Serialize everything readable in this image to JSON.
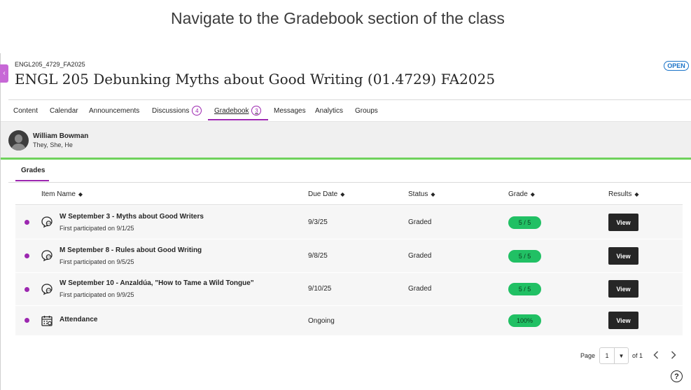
{
  "instruction": "Navigate to the Gradebook section of the class",
  "course": {
    "code": "ENGL205_4729_FA2025",
    "title": "ENGL 205 Debunking Myths about Good Writing (01.4729) FA2025",
    "status_badge": "OPEN"
  },
  "nav": {
    "tabs": [
      {
        "label": "Content"
      },
      {
        "label": "Calendar"
      },
      {
        "label": "Announcements"
      },
      {
        "label": "Discussions",
        "count": "4"
      },
      {
        "label": "Gradebook",
        "count": "3",
        "active": true
      },
      {
        "label": "Messages"
      },
      {
        "label": "Analytics"
      },
      {
        "label": "Groups"
      }
    ]
  },
  "user": {
    "name": "William Bowman",
    "pronouns": "They, She, He"
  },
  "grades": {
    "tab_label": "Grades",
    "columns": {
      "item_name": "Item Name",
      "due_date": "Due Date",
      "status": "Status",
      "grade": "Grade",
      "results": "Results"
    },
    "rows": [
      {
        "title": "W September 3 - Myths about Good Writers",
        "sub": "First participated on 9/1/25",
        "due": "9/3/25",
        "status": "Graded",
        "grade": "5 / 5",
        "result": "View",
        "icon": "discussion-icon"
      },
      {
        "title": "M September 8 - Rules about Good Writing",
        "sub": "First participated on 9/5/25",
        "due": "9/8/25",
        "status": "Graded",
        "grade": "5 / 5",
        "result": "View",
        "icon": "discussion-icon"
      },
      {
        "title": "W September 10 - Anzaldúa, \"How to Tame a Wild Tongue\"",
        "sub": "First participated on 9/9/25",
        "due": "9/10/25",
        "status": "Graded",
        "grade": "5 / 5",
        "result": "View",
        "icon": "discussion-icon"
      },
      {
        "title": "Attendance",
        "sub": "",
        "due": "Ongoing",
        "status": "",
        "grade": "100%",
        "result": "View",
        "icon": "calendar-icon"
      }
    ]
  },
  "pager": {
    "page_label": "Page",
    "current": "1",
    "of_label": "of 1"
  },
  "colors": {
    "accent": "#9c27b0",
    "grade_pill": "#21c064",
    "highlight_bar": "#6fd25c",
    "open_badge": "#1a73c8"
  }
}
